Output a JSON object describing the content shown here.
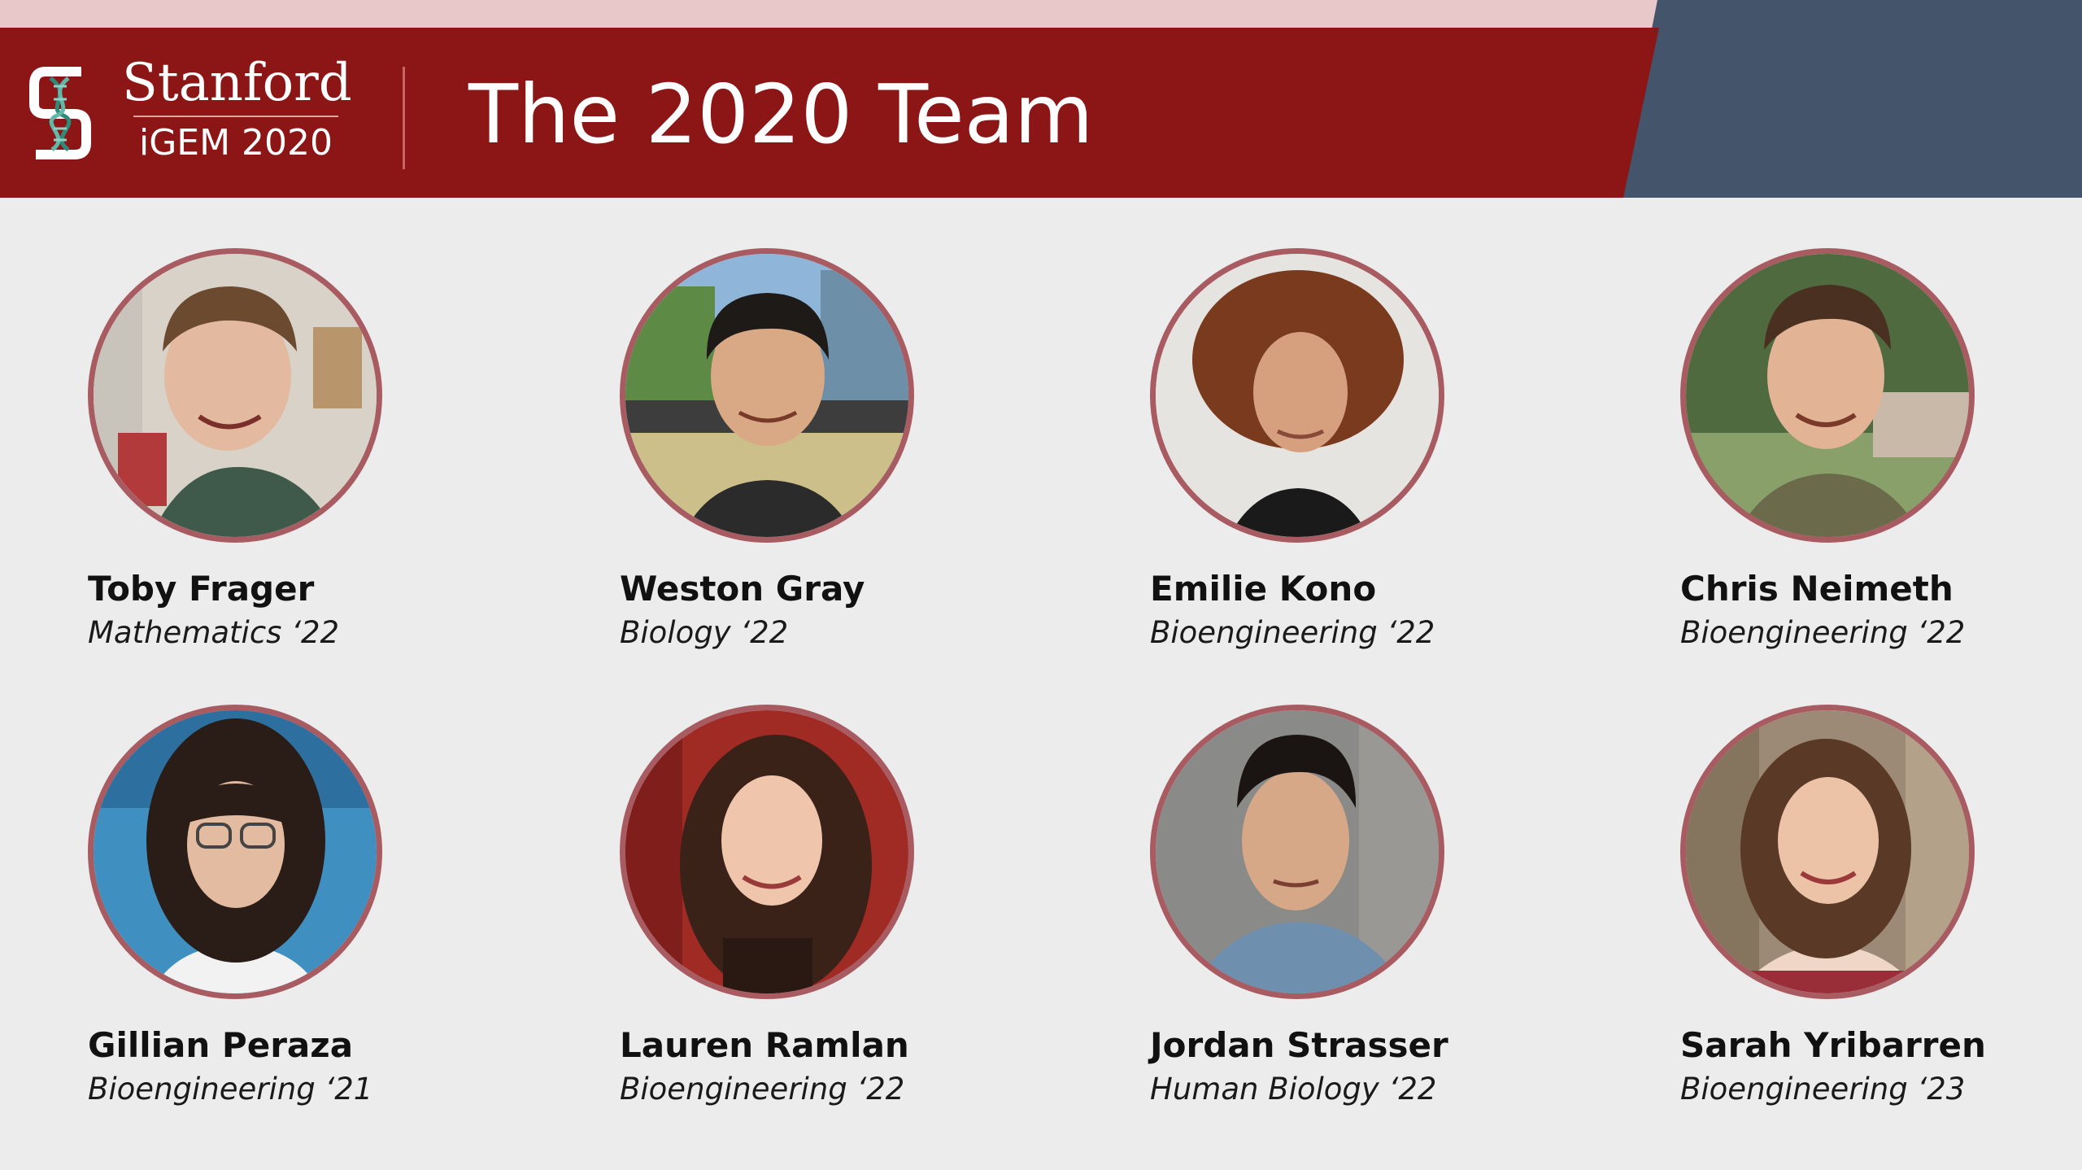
{
  "header": {
    "logo_name": "Stanford",
    "logo_sub": "iGEM 2020",
    "title": "The 2020 Team"
  },
  "colors": {
    "banner": "#8c1515",
    "accent_slate": "#44546a",
    "top_stripe": "#e8c8c9",
    "photo_ring": "#a85c62",
    "background": "#ececec"
  },
  "members": [
    {
      "name": "Toby Frager",
      "major": "Mathematics ‘22"
    },
    {
      "name": "Weston Gray",
      "major": "Biology ‘22"
    },
    {
      "name": "Emilie Kono",
      "major": "Bioengineering ‘22"
    },
    {
      "name": "Chris Neimeth",
      "major": "Bioengineering ‘22"
    },
    {
      "name": "Gillian Peraza",
      "major": "Bioengineering ‘21"
    },
    {
      "name": "Lauren Ramlan",
      "major": "Bioengineering ‘22"
    },
    {
      "name": "Jordan Strasser",
      "major": "Human Biology ‘22"
    },
    {
      "name": "Sarah Yribarren",
      "major": "Bioengineering ‘23"
    }
  ]
}
